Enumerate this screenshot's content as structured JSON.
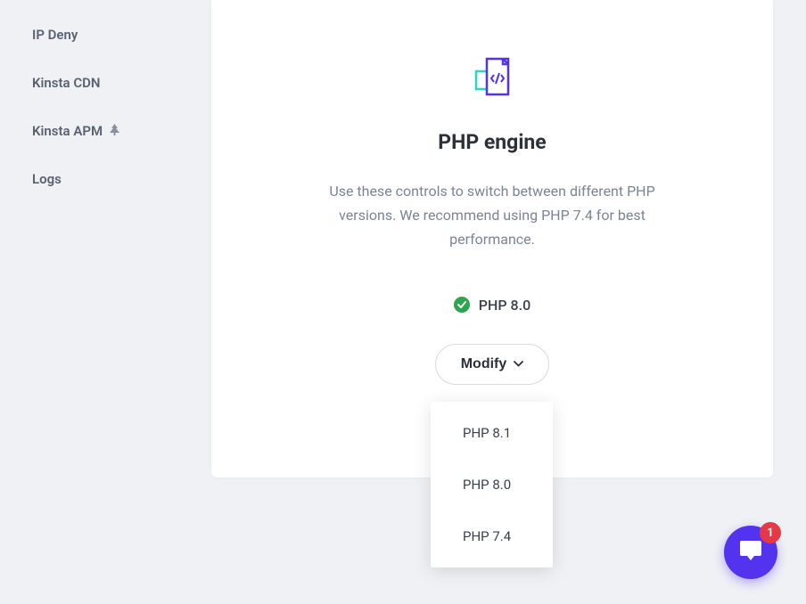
{
  "sidebar": {
    "items": [
      {
        "label": "IP Deny"
      },
      {
        "label": "Kinsta CDN"
      },
      {
        "label": "Kinsta APM",
        "has_icon": true
      },
      {
        "label": "Logs"
      }
    ]
  },
  "card": {
    "title": "PHP engine",
    "description": "Use these controls to switch between different PHP versions. We recommend using PHP 7.4 for best performance.",
    "current_version": "PHP 8.0",
    "modify_label": "Modify"
  },
  "dropdown": {
    "options": [
      "PHP 8.1",
      "PHP 8.0",
      "PHP 7.4"
    ]
  },
  "chat": {
    "badge_count": "1"
  }
}
